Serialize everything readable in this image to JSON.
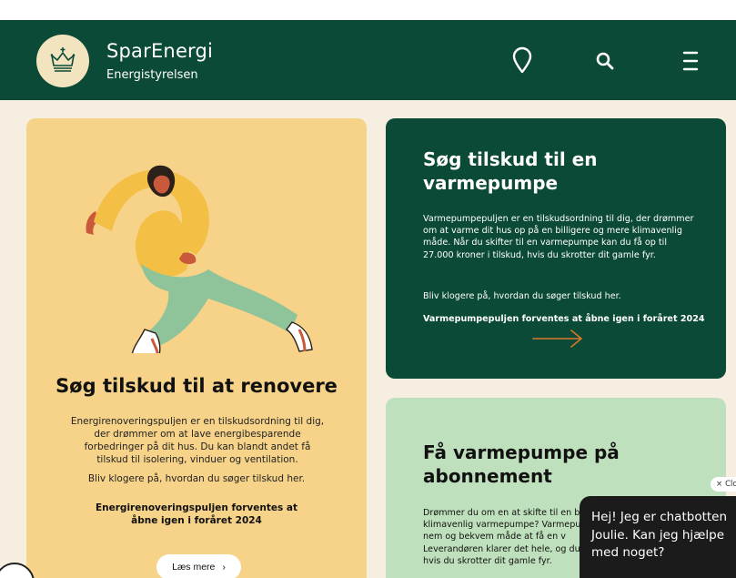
{
  "header": {
    "brand_title": "SparEnergi",
    "brand_subtitle": "Energistyrelsen",
    "icons": [
      "location-pin-icon",
      "search-icon",
      "menu-icon"
    ],
    "colors": {
      "header_bg": "#0b4a36",
      "logo_bg": "#f3e4c0"
    }
  },
  "cards": {
    "renovate": {
      "title": "Søg tilskud til at renovere",
      "body": "Energirenoveringspuljen er en tilskudsordning til dig, der drømmer om at lave energibesparende forbedringer på dit hus. Du kan blandt andet få tilskud til isolering, vinduer og ventilation.",
      "more": "Bliv klogere på, hvordan du søger tilskud her.",
      "note": "Energirenoveringspuljen forventes at åbne igen i foråret 2024",
      "button_label": "Læs mere",
      "button_icon": "›",
      "color": "#f6d389"
    },
    "heatpump": {
      "title": "Søg tilskud til en varmepumpe",
      "body": "Varmepumpepuljen er en tilskudsordning til dig, der drømmer om at varme dit hus op på en billigere og mere klimavenlig måde. Når du skifter til en varmepumpe kan du få op til 27.000 kroner i tilskud, hvis du skrotter dit gamle fyr.",
      "more": "Bliv klogere på, hvordan du søger tilskud her.",
      "note": "Varmepumpepuljen forventes at åbne igen i foråret 2024",
      "color": "#0b4a36",
      "arrow_color": "#d9762b"
    },
    "subscription": {
      "title": "Få varmepumpe på abonnement",
      "body": "Drømmer du om en at skifte til en b klimavenlig varmepumpe? Varmepu en nem og bekvem måde at få en v Leverandøren klarer det hele, og du hvis du skrotter dit gamle fyr.",
      "color": "#bfe0bc"
    }
  },
  "chat": {
    "close_label": "Clo",
    "close_icon": "×",
    "message": "Hej! Jeg er chatbotten Joulie. Kan jeg hjælpe med noget?"
  }
}
